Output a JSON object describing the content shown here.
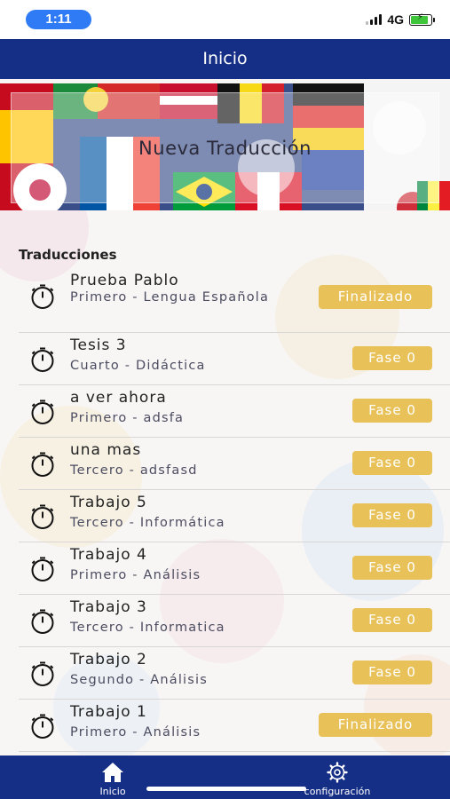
{
  "status_bar": {
    "time": "1:11",
    "network": "4G",
    "battery_level": 0.85
  },
  "header": {
    "title": "Inicio"
  },
  "hero": {
    "button_label": "Nueva Traducción"
  },
  "section": {
    "title": "Traducciones"
  },
  "translations": [
    {
      "title": "Prueba Pablo",
      "subtitle": "Primero - Lengua Española",
      "status": "Finalizado"
    },
    {
      "title": "Tesis 3",
      "subtitle": "Cuarto - Didáctica",
      "status": "Fase 0"
    },
    {
      "title": "a ver ahora",
      "subtitle": "Primero - adsfa",
      "status": "Fase 0"
    },
    {
      "title": "una mas",
      "subtitle": "Tercero - adsfasd",
      "status": "Fase 0"
    },
    {
      "title": "Trabajo 5",
      "subtitle": "Tercero - Informática",
      "status": "Fase 0"
    },
    {
      "title": "Trabajo 4",
      "subtitle": "Primero - Análisis",
      "status": "Fase 0"
    },
    {
      "title": "Trabajo 3",
      "subtitle": "Tercero - Informatica",
      "status": "Fase 0"
    },
    {
      "title": "Trabajo 2",
      "subtitle": "Segundo - Análisis",
      "status": "Fase 0"
    },
    {
      "title": "Trabajo 1",
      "subtitle": "Primero - Análisis",
      "status": "Finalizado"
    }
  ],
  "tabs": {
    "home": {
      "label": "Inicio",
      "icon": "home-icon"
    },
    "config": {
      "label": "configuración",
      "icon": "gear-icon"
    }
  },
  "colors": {
    "nav": "#162f86",
    "badge": "#e8c158",
    "status_pill": "#2f7bf5"
  }
}
